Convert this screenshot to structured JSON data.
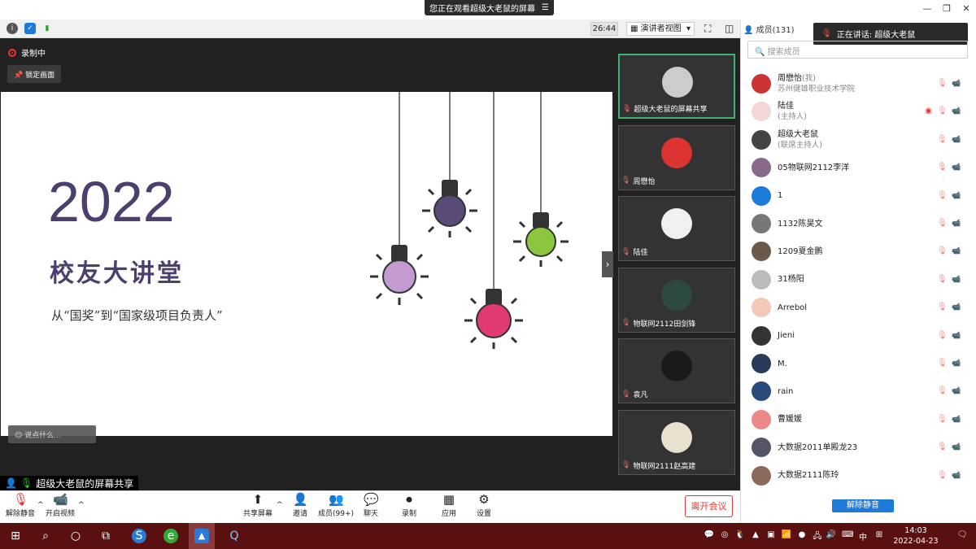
{
  "banner": {
    "text": "您正在观看超级大老鼠的屏幕",
    "menu_icon": "menu-icon"
  },
  "window": {
    "minimize": "—",
    "restore": "❐",
    "close": "✕"
  },
  "toolbar": {
    "timer": "26:44",
    "view": "演讲者视图",
    "view_arrow": "▾"
  },
  "recording": {
    "label": "录制中"
  },
  "lock": {
    "label": "锁定画面"
  },
  "slide": {
    "year": "2022",
    "title": "校友大讲堂",
    "subtitle": "从“国奖”到“国家级项目负责人”"
  },
  "chat_input": {
    "placeholder": "说点什么..."
  },
  "share_label": "超级大老鼠的屏幕共享",
  "videos": [
    {
      "name": "超级大老鼠的屏幕共享",
      "color": "#ccc",
      "active": true
    },
    {
      "name": "周懋怡",
      "color": "#d33",
      "active": false
    },
    {
      "name": "陆佳",
      "color": "#f0f0f0",
      "active": false
    },
    {
      "name": "物联网2112田剑锋",
      "color": "#2d4a3e",
      "active": false
    },
    {
      "name": "袁凡",
      "color": "#1a1a1a",
      "active": false
    },
    {
      "name": "物联网2111赵高建",
      "color": "#eae0d0",
      "active": false
    }
  ],
  "panel": {
    "title": "成员(131)",
    "speaking": "正在讲话: 超级大老鼠",
    "search_placeholder": "搜索成员",
    "unmute_all": "解除静音"
  },
  "members": [
    {
      "name": "周懋怡",
      "role": "(我)",
      "sub": "苏州健雄职业技术学院",
      "color": "#c33"
    },
    {
      "name": "陆佳",
      "role": "",
      "sub": "(主持人)",
      "color": "#f3d6d6"
    },
    {
      "name": "超级大老鼠",
      "role": "",
      "sub": "(联席主持人)",
      "color": "#444"
    },
    {
      "name": "05物联网2112李洋",
      "role": "",
      "sub": "",
      "color": "#8a6a8a"
    },
    {
      "name": "1",
      "role": "",
      "sub": "",
      "color": "#1e7ad8"
    },
    {
      "name": "1132陈昊文",
      "role": "",
      "sub": "",
      "color": "#777"
    },
    {
      "name": "1209夏金鹏",
      "role": "",
      "sub": "",
      "color": "#6b5a4a"
    },
    {
      "name": "31杨阳",
      "role": "",
      "sub": "",
      "color": "#bbb"
    },
    {
      "name": "Arrebol",
      "role": "",
      "sub": "",
      "color": "#f3c8b8"
    },
    {
      "name": "Jieni",
      "role": "",
      "sub": "",
      "color": "#333"
    },
    {
      "name": "M.",
      "role": "",
      "sub": "",
      "color": "#2a3a5a"
    },
    {
      "name": "rain",
      "role": "",
      "sub": "",
      "color": "#2a4a7a"
    },
    {
      "name": "曹媛媛",
      "role": "",
      "sub": "",
      "color": "#e88"
    },
    {
      "name": "大数据2011单殿龙23",
      "role": "",
      "sub": "",
      "color": "#556"
    },
    {
      "name": "大数据2111陈玲",
      "role": "",
      "sub": "",
      "color": "#8a6a5a"
    }
  ],
  "bottom": {
    "mute": "解除静音",
    "video": "开启视频",
    "share": "共享屏幕",
    "invite": "邀请",
    "members": "成员(99+)",
    "chat": "聊天",
    "record": "录制",
    "apps": "应用",
    "settings": "设置",
    "leave": "离开会议"
  },
  "taskbar": {
    "time": "14:03",
    "date": "2022-04-23",
    "ime": "中"
  }
}
